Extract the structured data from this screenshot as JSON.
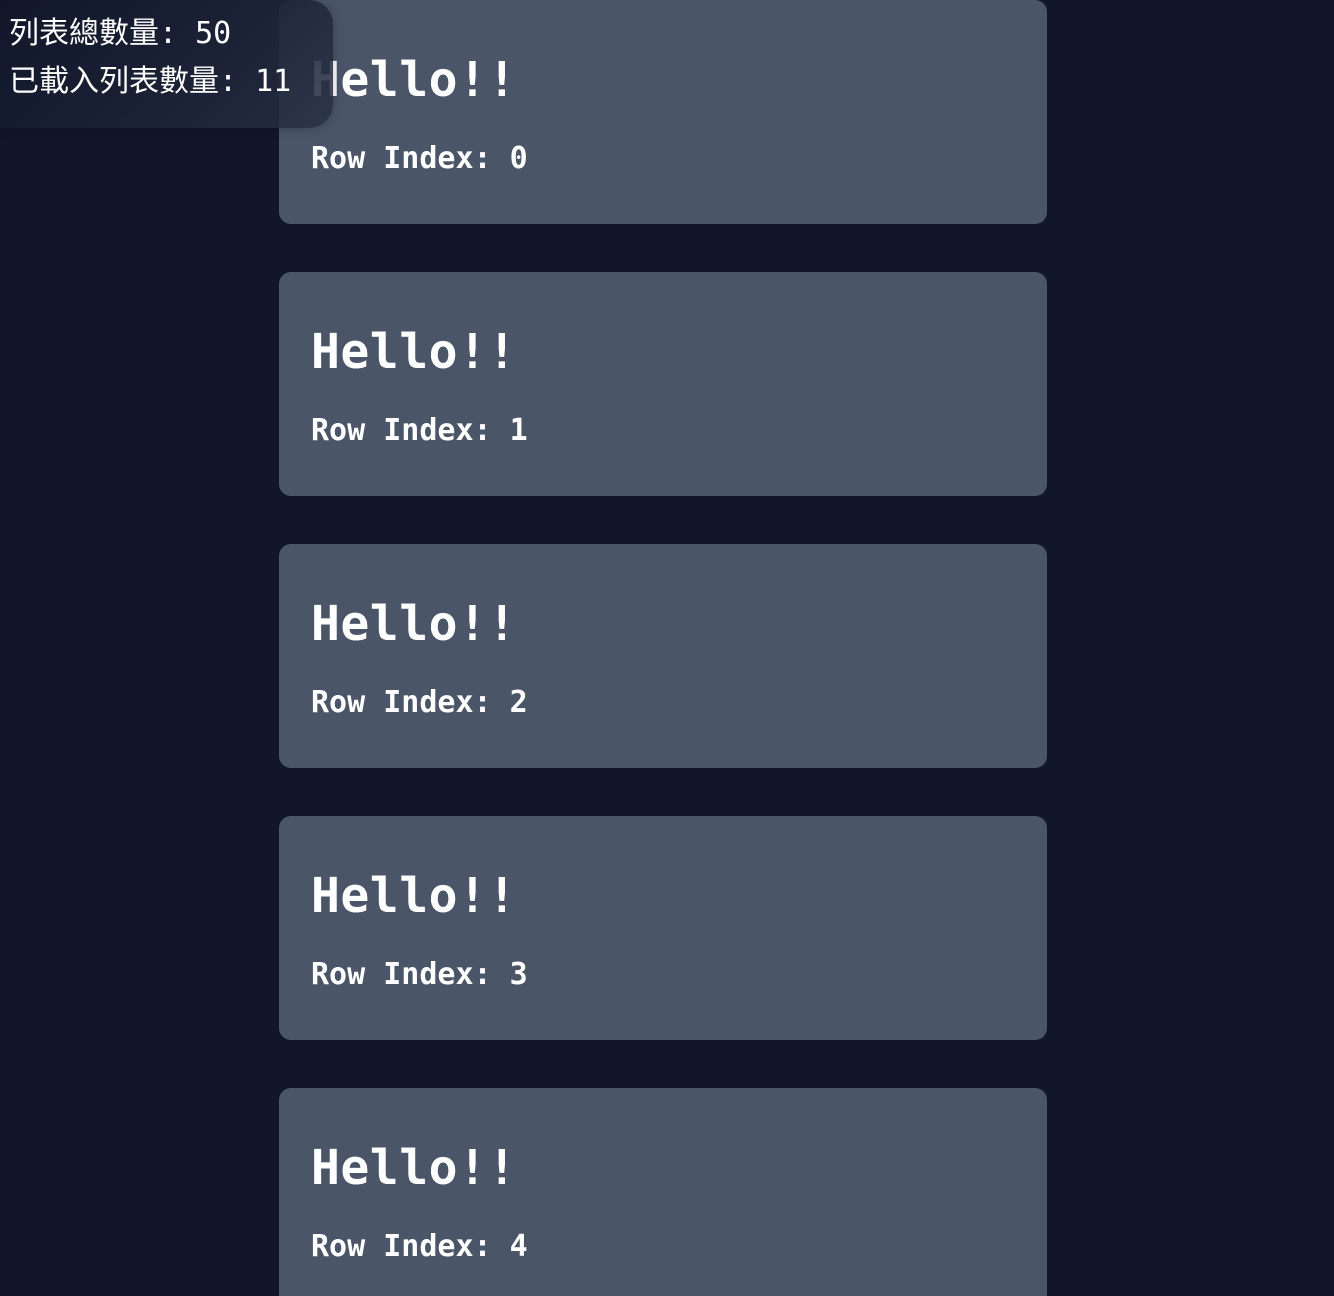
{
  "stats": {
    "total_label": "列表總數量: ",
    "total_value": "50",
    "loaded_label": "已載入列表數量: ",
    "loaded_value": "11"
  },
  "cards": [
    {
      "title": "Hello!!",
      "index_label": "Row Index: 0"
    },
    {
      "title": "Hello!!",
      "index_label": "Row Index: 1"
    },
    {
      "title": "Hello!!",
      "index_label": "Row Index: 2"
    },
    {
      "title": "Hello!!",
      "index_label": "Row Index: 3"
    },
    {
      "title": "Hello!!",
      "index_label": "Row Index: 4"
    }
  ],
  "colors": {
    "background": "#111729",
    "card": "#4a5568",
    "text": "#ffffff"
  }
}
